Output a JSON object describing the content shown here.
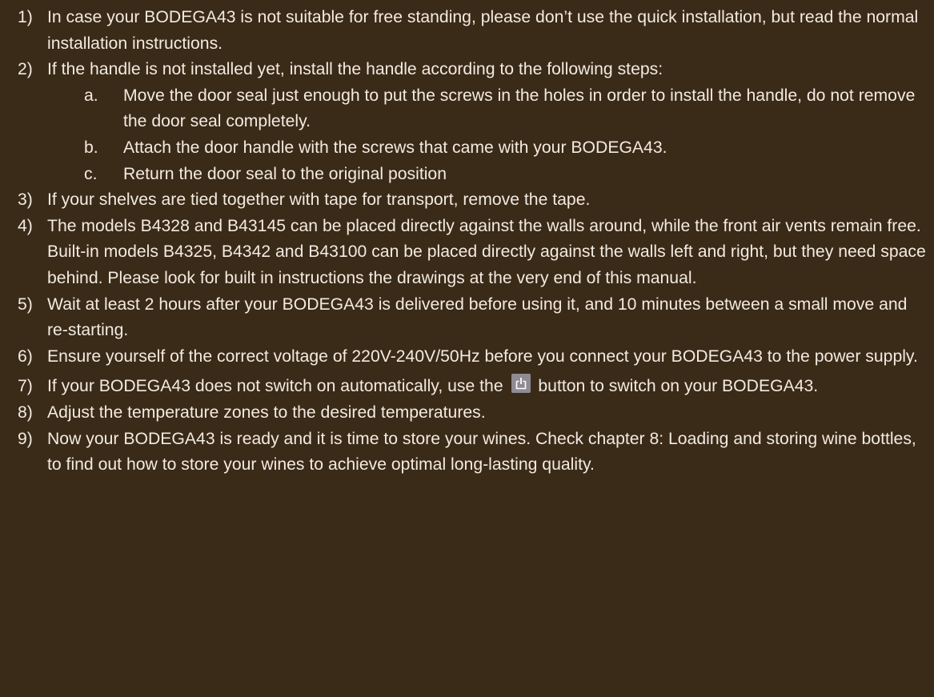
{
  "items": [
    {
      "num": "1)",
      "text": "In case your BODEGA43 is not suitable for free standing, please don’t use the quick installation, but read the normal installation instructions."
    },
    {
      "num": "2)",
      "text": "If the handle is not installed yet, install the handle according to the following steps:"
    },
    {
      "num": "3)",
      "text": "If your shelves are tied together with tape for transport, remove the tape."
    },
    {
      "num": "4)",
      "text": "The models B4328 and B43145 can be placed directly against the walls around, while the front air vents remain free. Built-in models B4325, B4342 and B43100 can be placed directly against the walls left and right, but they need space behind. Please look for built in instructions the drawings at the very end of this manual."
    },
    {
      "num": "5)",
      "text": "Wait at least 2 hours after your BODEGA43 is delivered before using it, and 10 minutes between a small move and re-starting."
    },
    {
      "num": "6)",
      "text": "Ensure yourself of the correct voltage of 220V-240V/50Hz before you connect your BODEGA43 to the power supply."
    },
    {
      "num": "7)",
      "text_before": "If your BODEGA43 does not switch on automatically, use the",
      "text_after": "button to switch on your BODEGA43."
    },
    {
      "num": "8)",
      "text": "Adjust the temperature zones to the desired temperatures."
    },
    {
      "num": "9)",
      "text": "Now your BODEGA43 is ready and it is time to store your wines. Check chapter 8: Loading and storing wine bottles, to find out how to store your wines to achieve optimal long-lasting quality."
    }
  ],
  "subitems": [
    {
      "letter": "a.",
      "text": "Move the door seal just enough to put the screws in the holes in order to install the handle, do not remove the door seal completely."
    },
    {
      "letter": "b.",
      "text": "Attach the door handle with the screws that came with your BODEGA43."
    },
    {
      "letter": "c.",
      "text": "Return the door seal to the original position"
    }
  ],
  "icons": {
    "power_button": "power-icon"
  },
  "colors": {
    "background": "#3a2a18",
    "text": "#f2ebe1",
    "icon_bg": "#8f8a93"
  }
}
